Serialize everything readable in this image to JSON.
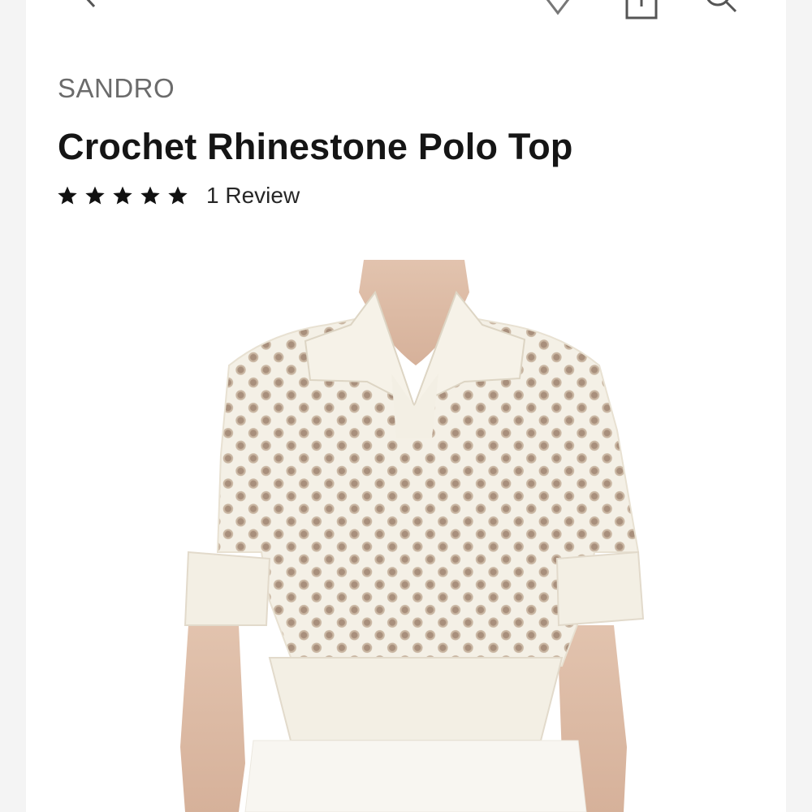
{
  "header": {
    "back_icon": "chevron-left-icon",
    "wishlist_icon": "heart-icon",
    "share_icon": "share-icon",
    "search_icon": "search-icon"
  },
  "product": {
    "brand": "SANDRO",
    "title": "Crochet Rhinestone Polo Top",
    "rating_stars": 5,
    "rating_max": 5,
    "review_label": "1 Review"
  },
  "colors": {
    "title": "#151515",
    "brand": "#6b6b6b",
    "garment": "#f3efe4",
    "background": "#ffffff"
  }
}
